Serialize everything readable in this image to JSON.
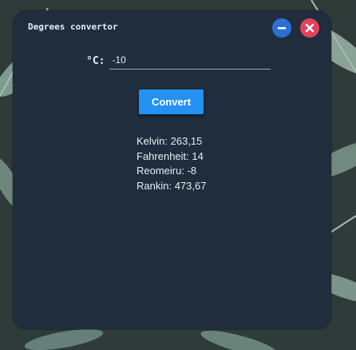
{
  "window": {
    "title": "Degrees convertor"
  },
  "controls": {
    "minimize_icon": "minus-icon",
    "close_icon": "close-icon",
    "minimize_color": "#2c6fd6",
    "close_color": "#e2445c"
  },
  "input": {
    "label": "°C:",
    "value": "-10"
  },
  "convert_button": {
    "label": "Convert",
    "color": "#2392f2"
  },
  "results": [
    {
      "text": "Kelvin: 263,15"
    },
    {
      "text": "Fahrenheit: 14"
    },
    {
      "text": "Reomeiru: -8"
    },
    {
      "text": "Rankin: 473,67"
    }
  ]
}
